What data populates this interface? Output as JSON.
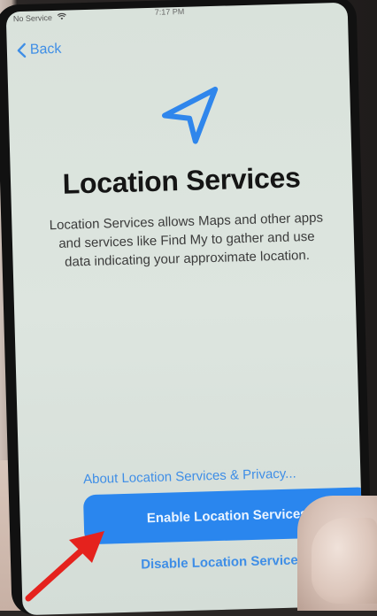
{
  "status_bar": {
    "carrier": "No Service",
    "time": "7:17 PM"
  },
  "nav": {
    "back_label": "Back"
  },
  "icons": {
    "back": "chevron-left-icon",
    "location": "location-arrow-icon",
    "wifi": "wifi-icon",
    "annotation": "red-arrow-icon"
  },
  "content": {
    "title": "Location Services",
    "description": "Location Services allows Maps and other apps and services like Find My to gather and use data indicating your approximate location."
  },
  "actions": {
    "privacy_link": "About Location Services & Privacy...",
    "enable_label": "Enable Location Services",
    "disable_label": "Disable Location Services"
  },
  "colors": {
    "accent": "#3f8ee6",
    "primary_button": "#2a86ee",
    "annotation": "#e5221d"
  }
}
